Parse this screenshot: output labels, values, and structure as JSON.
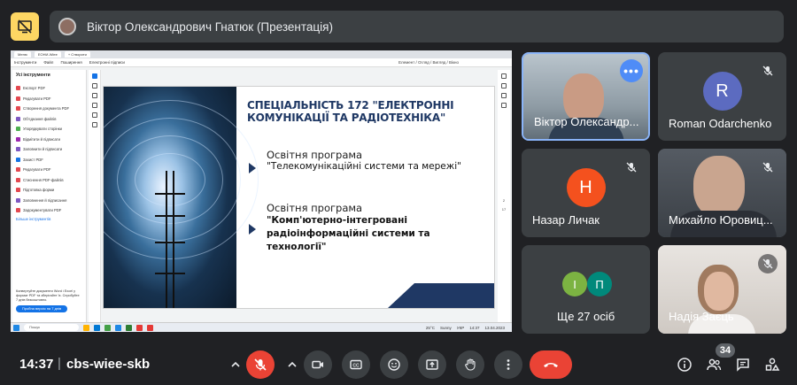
{
  "presenter": {
    "title": "Віктор Олександрович Гнатюк (Презентація)",
    "present_icon": "present-to-all-off-icon"
  },
  "shared_screen": {
    "browser_tabs": [
      "Меню",
      "ЕОНИ-Wiee",
      "+ Створити"
    ],
    "toolbar_items": [
      "Інструменти",
      "Файл",
      "Поширення",
      "Електронні підписи"
    ],
    "toolbar_right": "Елемент / Огляд / Вигляд / Вікно",
    "tools_title": "Усі інструменти",
    "tools": [
      {
        "label": "Експорт PDF",
        "color": "#e34850"
      },
      {
        "label": "Редагувати PDF",
        "color": "#e34850"
      },
      {
        "label": "Створення документа PDF",
        "color": "#e34850"
      },
      {
        "label": "Об'єднання файлів",
        "color": "#7e57c2"
      },
      {
        "label": "Упорядкувати сторінки",
        "color": "#4caf50"
      },
      {
        "label": "Відмітити й підписати",
        "color": "#9c27b0"
      },
      {
        "label": "Заповнити й підписати",
        "color": "#7e57c2"
      },
      {
        "label": "Захист PDF",
        "color": "#1473e6"
      },
      {
        "label": "Редагувати PDF",
        "color": "#e34850"
      },
      {
        "label": "Стиснення PDF-файлів",
        "color": "#e34850"
      },
      {
        "label": "Підготовка форми",
        "color": "#e34850"
      },
      {
        "label": "Заповнення й підписання",
        "color": "#7e57c2"
      },
      {
        "label": "Задокументувати PDF",
        "color": "#e34850"
      }
    ],
    "tools_more": "Більше інструментів",
    "promo_text": "Конвертуйте документи Word і Excel у формат PDF та зберігайте їх. Спробуйте 7 днів безкоштовно.",
    "promo_button": "Пробна версія на 7 днів",
    "slide": {
      "title": "СПЕЦІАЛЬНІСТЬ 172 \"ЕЛЕКТРОННІ КОМУНІКАЦІЇ ТА РАДІОТЕХНІКА\"",
      "program_label_1": "Освітня програма",
      "program_name_1": "\"Телекомунікаційні системи та мережі\"",
      "program_label_2": "Освітня програма",
      "program_name_2": "\"Комп'ютерно-інтегровані радіоінформаційні системи та технології\""
    },
    "page_numbers": [
      "2",
      "17"
    ],
    "taskbar": {
      "search": "Пошук",
      "temperature": "25°C",
      "weather": "Sunny",
      "lang": "УКР",
      "time": "14:37",
      "date": "13.04.2023"
    }
  },
  "participants": [
    {
      "name": "Віктор Олександр...",
      "type": "video",
      "state": "active-speaker",
      "more_icon": "more-horiz-icon"
    },
    {
      "name": "Roman Odarchenko",
      "type": "avatar",
      "letter": "R",
      "avatar_color": "#5c6bc0",
      "muted": true
    },
    {
      "name": "Назар Личак",
      "type": "avatar",
      "letter": "Н",
      "avatar_color": "#f4511e",
      "muted": true
    },
    {
      "name": "Михайло Юровиц...",
      "type": "video",
      "muted": true
    },
    {
      "name": "Ще 27 осіб",
      "type": "group",
      "letters": [
        "І",
        "П"
      ],
      "letter_colors": [
        "#7cb342",
        "#00897b"
      ]
    },
    {
      "name": "Надія Заєць",
      "type": "video",
      "muted": true
    }
  ],
  "bottom_bar": {
    "time": "14:37",
    "separator": "|",
    "meeting_code": "cbs-wiee-skb",
    "participant_count": "34",
    "controls": [
      "audio-options-caret",
      "mic-off-button",
      "video-options-caret",
      "camera-button",
      "captions-button",
      "emoji-button",
      "present-button",
      "raise-hand-button",
      "more-options-button",
      "leave-call-button"
    ],
    "right_icons": [
      "info-icon",
      "people-icon",
      "chat-icon",
      "activities-icon"
    ]
  },
  "colors": {
    "background": "#202124",
    "tile": "#3c4043",
    "leave": "#ea4335",
    "present_badge": "#fdd663",
    "active_speaker_border": "#8ab4f8"
  }
}
